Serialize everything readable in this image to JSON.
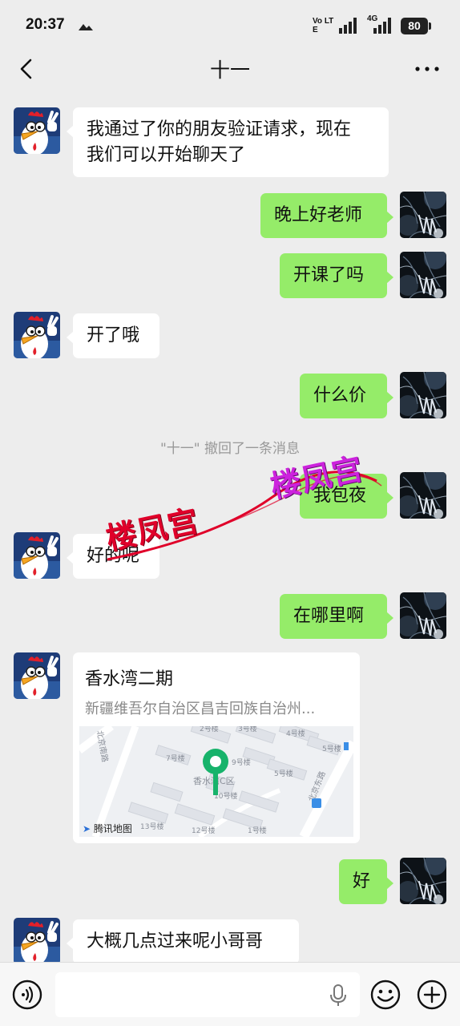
{
  "status_bar": {
    "time": "20:37",
    "network_label": "Vo LTE",
    "network_4g": "4G",
    "battery": "80"
  },
  "header": {
    "title": "十一"
  },
  "messages": [
    {
      "side": "in",
      "text_lines": [
        "我通过了你的朋友验证请求，现在",
        "我们可以开始聊天了"
      ]
    },
    {
      "side": "out",
      "text": "晚上好老师"
    },
    {
      "side": "out",
      "text": "开课了吗"
    },
    {
      "side": "in",
      "text": "开了哦"
    },
    {
      "side": "out",
      "text": "什么价"
    },
    {
      "side": "system",
      "text": "\"十一\" 撤回了一条消息"
    },
    {
      "side": "out",
      "text": "我包夜"
    },
    {
      "side": "in",
      "text": "好的呢"
    },
    {
      "side": "out",
      "text": "在哪里啊"
    },
    {
      "side": "in",
      "type": "location",
      "title": "香水湾二期",
      "address": "新疆维吾尔自治区昌吉回族自治州...",
      "map_labels": [
        "2号楼",
        "3号楼",
        "4号楼",
        "5号楼",
        "7号楼",
        "9号楼",
        "5号楼",
        "香水湾C区",
        "10号楼",
        "13号楼",
        "12号楼",
        "1号楼",
        "北京南路",
        "北京东路"
      ],
      "map_credit": "腾讯地图"
    },
    {
      "side": "out",
      "text": "好"
    },
    {
      "side": "in",
      "text": "大概几点过来呢小哥哥"
    }
  ],
  "watermark": {
    "text": "楼凤宫"
  },
  "input_bar": {
    "placeholder": ""
  },
  "colors": {
    "background": "#ededed",
    "outgoing_bubble": "#95ec69",
    "incoming_bubble": "#ffffff",
    "watermark_red": "#e0002a",
    "watermark_magenta": "#cc22dd",
    "map_pin": "#17b36b"
  }
}
